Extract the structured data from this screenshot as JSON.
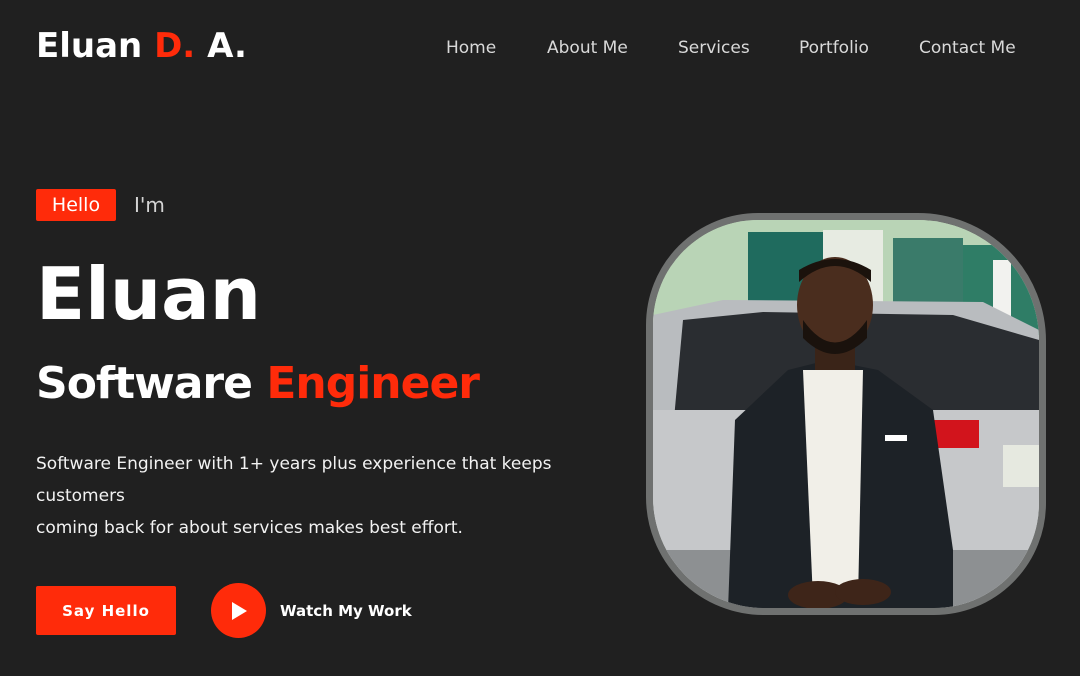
{
  "brand": {
    "first": "Eluan",
    "middle": "D.",
    "last": "A.",
    "accent_color": "#ff2b0a"
  },
  "nav": [
    {
      "label": "Home"
    },
    {
      "label": "About Me"
    },
    {
      "label": "Services"
    },
    {
      "label": "Portfolio"
    },
    {
      "label": "Contact Me"
    }
  ],
  "hero": {
    "badge": "Hello",
    "intro": "I'm",
    "name": "Eluan",
    "role_first": "Software",
    "role_accent": "Engineer",
    "description_lines": [
      "Software Engineer with 1+ years plus experience that keeps customers",
      "coming back for about services makes best effort."
    ],
    "cta_label": "Say Hello",
    "watch_label": "Watch My Work"
  },
  "photo": {
    "icon": "profile-photo"
  }
}
